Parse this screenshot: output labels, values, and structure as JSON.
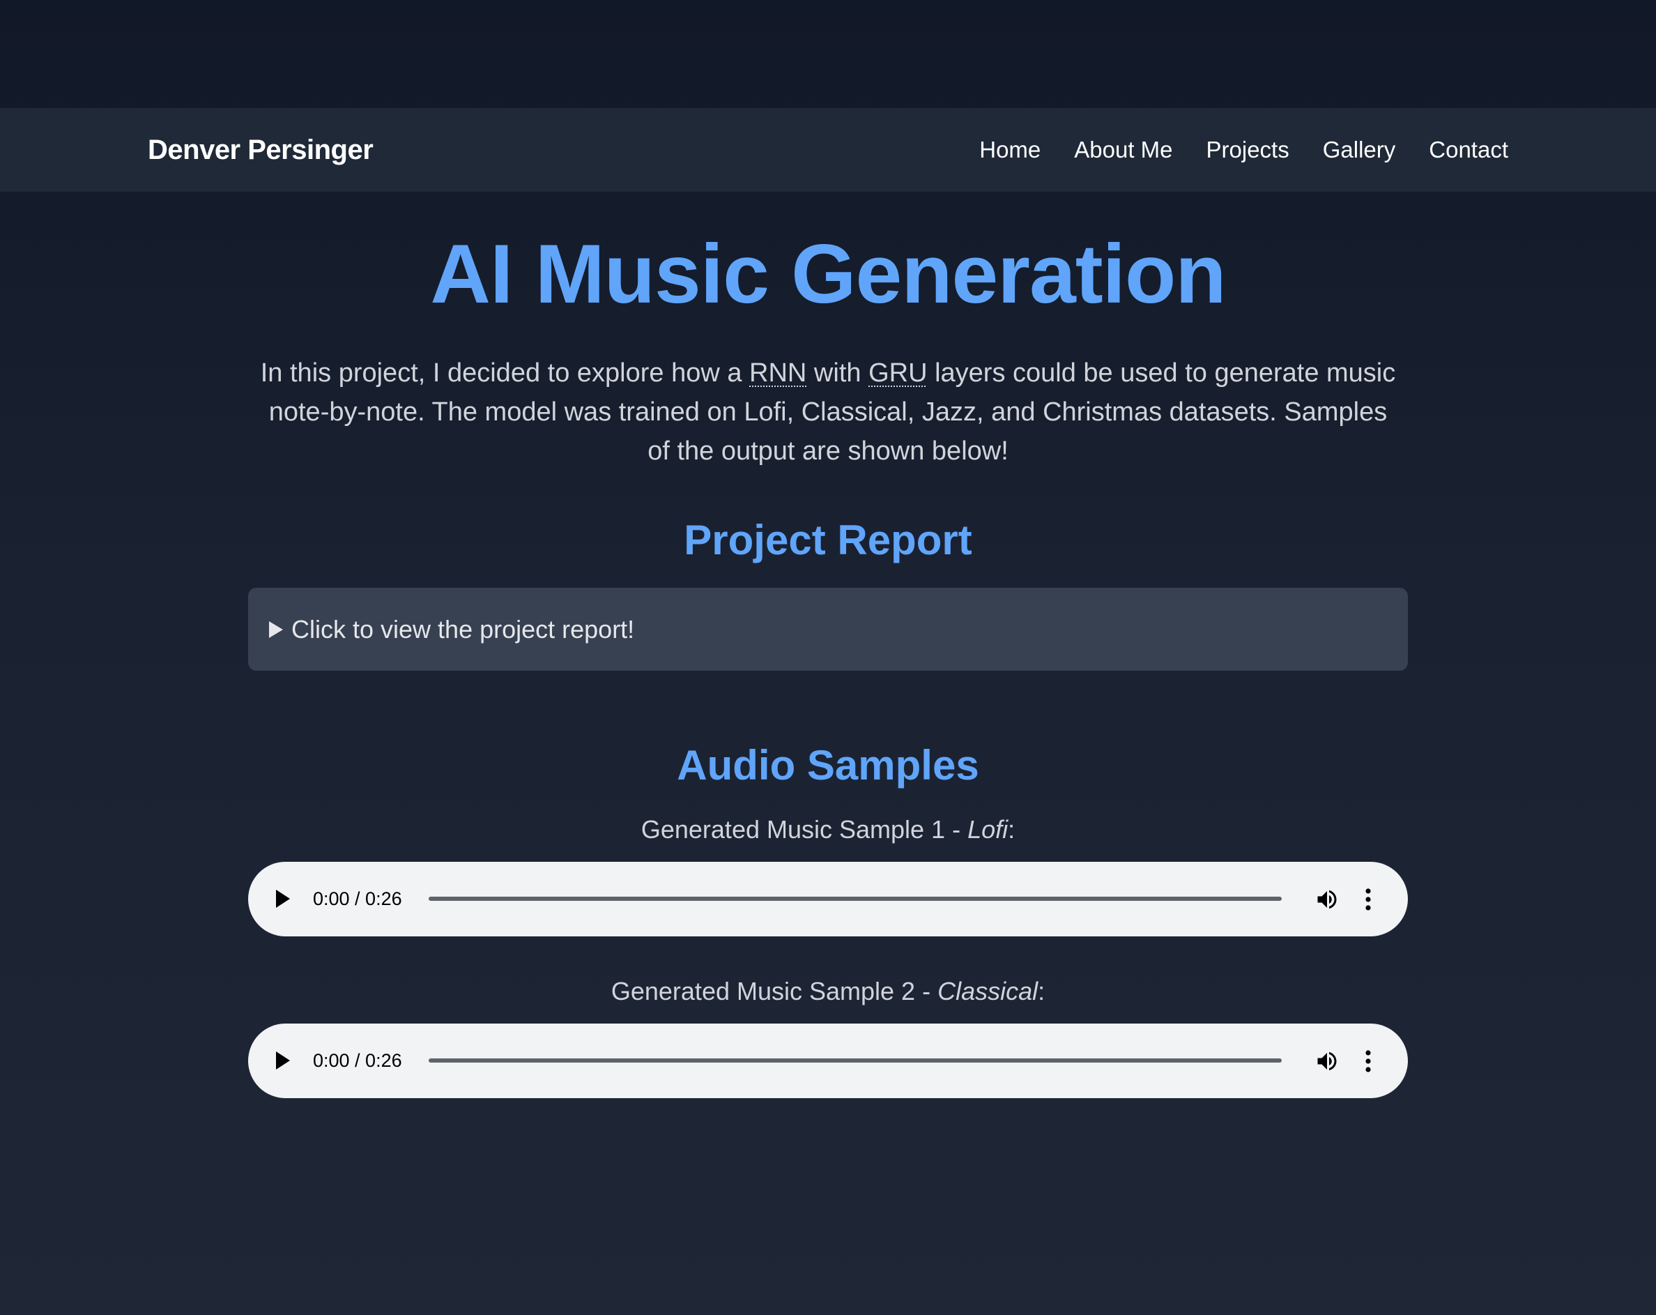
{
  "nav": {
    "brand": "Denver Persinger",
    "links": [
      "Home",
      "About Me",
      "Projects",
      "Gallery",
      "Contact"
    ]
  },
  "main": {
    "title": "AI Music Generation",
    "intro": {
      "part1": "In this project, I decided to explore how a ",
      "abbr1": "RNN",
      "part2": " with ",
      "abbr2": "GRU",
      "part3": " layers could be used to generate music note-by-note. The model was trained on Lofi, Classical, Jazz, and Christmas datasets. Samples of the output are shown below!"
    },
    "report": {
      "heading": "Project Report",
      "summary": "Click to view the project report!"
    },
    "audio": {
      "heading": "Audio Samples",
      "samples": [
        {
          "label_prefix": "Generated Music Sample 1 - ",
          "genre": "Lofi",
          "suffix": ":",
          "time": "0:00 / 0:26"
        },
        {
          "label_prefix": "Generated Music Sample 2 - ",
          "genre": "Classical",
          "suffix": ":",
          "time": "0:00 / 0:26"
        }
      ]
    }
  },
  "icons": {
    "play": "play-icon",
    "volume": "volume-icon",
    "more": "more-vertical-icon",
    "disclosure": "triangle-right-icon"
  },
  "colors": {
    "accent": "#60a5fa",
    "navbar": "#1f2937",
    "background": "#111827",
    "details": "#374151",
    "player": "#f1f3f4"
  }
}
